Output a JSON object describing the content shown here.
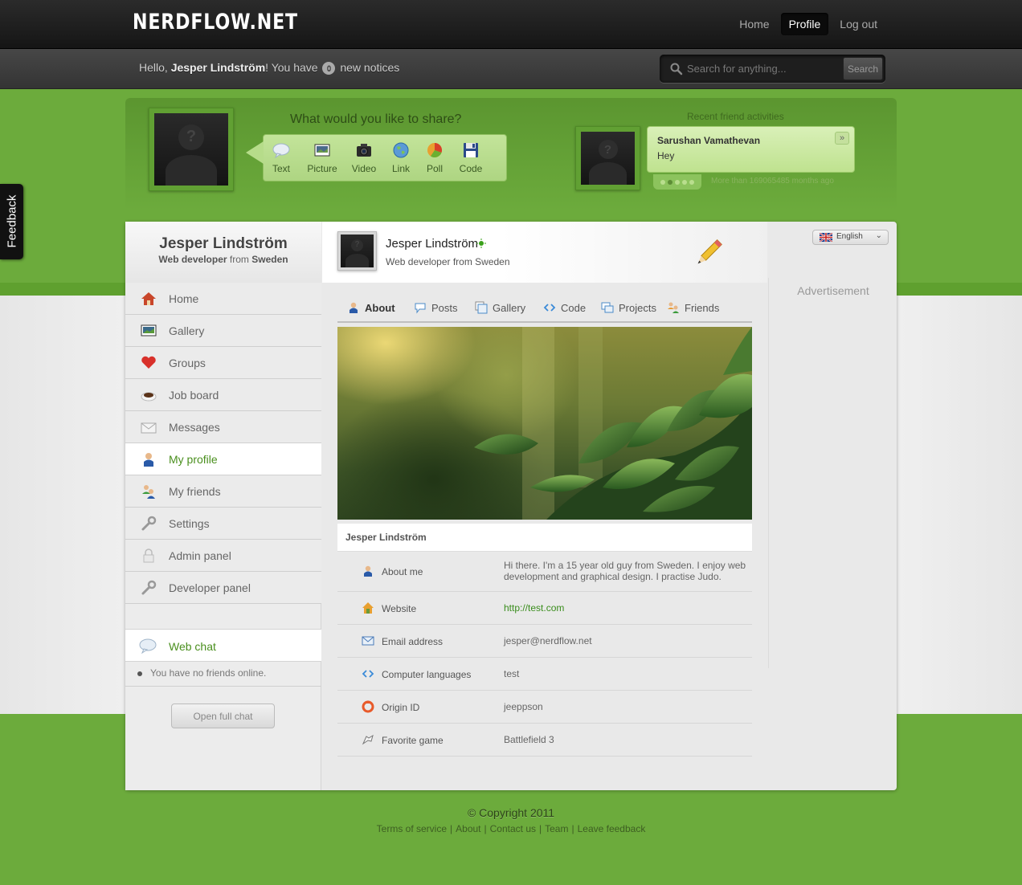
{
  "header": {
    "logo": "NERDFLOW.NET",
    "nav": [
      {
        "label": "Home",
        "active": false
      },
      {
        "label": "Profile",
        "active": true
      },
      {
        "label": "Log out",
        "active": false
      }
    ]
  },
  "subbar": {
    "greeting_prefix": "Hello,",
    "user_name": "Jesper Lindström",
    "greeting_mid": "! You have",
    "notice_count": "0",
    "greeting_suffix": "new notices",
    "search_placeholder": "Search for anything...",
    "search_button": "Search"
  },
  "share": {
    "title": "What would you like to share?",
    "items": [
      {
        "label": "Text",
        "icon": "speech-bubble-icon"
      },
      {
        "label": "Picture",
        "icon": "picture-icon"
      },
      {
        "label": "Video",
        "icon": "camera-icon"
      },
      {
        "label": "Link",
        "icon": "globe-icon"
      },
      {
        "label": "Poll",
        "icon": "pie-chart-icon"
      },
      {
        "label": "Code",
        "icon": "floppy-disk-icon"
      }
    ]
  },
  "recent": {
    "title": "Recent friend activities",
    "name": "Sarushan Vamathevan",
    "text": "Hey",
    "next": "»",
    "time": "More than 169065485 months ago"
  },
  "feedback": {
    "label": "Feedback"
  },
  "sidebar": {
    "name": "Jesper Lindström",
    "role_title": "Web developer",
    "role_from": "from",
    "role_place": "Sweden",
    "items": [
      {
        "label": "Home",
        "icon": "house-icon"
      },
      {
        "label": "Gallery",
        "icon": "picture-icon"
      },
      {
        "label": "Groups",
        "icon": "heart-icon"
      },
      {
        "label": "Job board",
        "icon": "coffee-cup-icon"
      },
      {
        "label": "Messages",
        "icon": "envelope-icon"
      },
      {
        "label": "My profile",
        "icon": "user-icon",
        "active": true
      },
      {
        "label": "My friends",
        "icon": "users-icon"
      },
      {
        "label": "Settings",
        "icon": "wrench-icon"
      },
      {
        "label": "Admin panel",
        "icon": "padlock-icon"
      },
      {
        "label": "Developer panel",
        "icon": "wrench-icon"
      }
    ],
    "chat_label": "Web chat",
    "chat_status": "You have no friends online.",
    "open_chat": "Open full chat"
  },
  "profile": {
    "name": "Jesper Lindström",
    "role": "Web developer from Sweden",
    "language": "English"
  },
  "tabs": [
    {
      "label": "About",
      "icon": "user-icon",
      "active": true
    },
    {
      "label": "Posts",
      "icon": "speech-bubble-icon"
    },
    {
      "label": "Gallery",
      "icon": "gallery-icon"
    },
    {
      "label": "Code",
      "icon": "code-icon"
    },
    {
      "label": "Projects",
      "icon": "projects-icon"
    },
    {
      "label": "Friends",
      "icon": "users-icon"
    }
  ],
  "advertisement": "Advertisement",
  "info": {
    "title": "Jesper Lindström",
    "rows": [
      {
        "label": "About me",
        "value": "Hi there. I'm a 15 year old guy from Sweden. I enjoy web development and graphical design. I practise Judo.",
        "icon": "user-icon"
      },
      {
        "label": "Website",
        "value": "http://test.com",
        "icon": "house-icon"
      },
      {
        "label": "Email address",
        "value": "jesper@nerdflow.net",
        "icon": "envelope-icon"
      },
      {
        "label": "Computer languages",
        "value": "test",
        "icon": "code-icon"
      },
      {
        "label": "Origin ID",
        "value": "jeeppson",
        "icon": "origin-icon"
      },
      {
        "label": "Favorite game",
        "value": "Battlefield 3",
        "icon": "gamepad-icon"
      }
    ]
  },
  "footer": {
    "copyright": "© Copyright 2011",
    "links": [
      "Terms of service",
      "About",
      "Contact us",
      "Team",
      "Leave feedback"
    ]
  },
  "colors": {
    "brand_green": "#6cab3c",
    "link_green": "#3a8d1d",
    "dark_bar": "#1c1c1c"
  }
}
